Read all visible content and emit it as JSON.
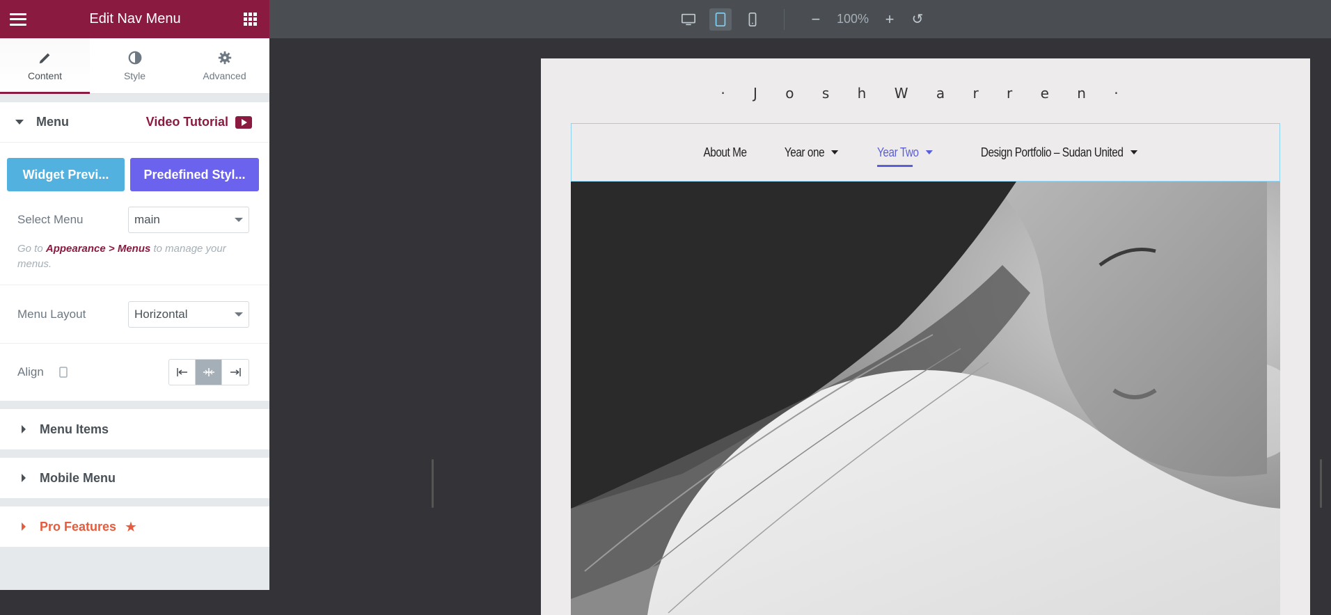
{
  "panel": {
    "title": "Edit Nav Menu",
    "tabs": [
      {
        "label": "Content",
        "icon": "pencil-icon"
      },
      {
        "label": "Style",
        "icon": "half-circle-icon"
      },
      {
        "label": "Advanced",
        "icon": "gear-icon"
      }
    ],
    "menu_section": {
      "title": "Menu",
      "video_tutorial": "Video Tutorial",
      "widget_preview_btn": "Widget Previ...",
      "predefined_style_btn": "Predefined Styl...",
      "select_menu_label": "Select Menu",
      "select_menu_value": "main",
      "hint_prefix": "Go to ",
      "hint_link": "Appearance > Menus",
      "hint_suffix": " to manage your menus.",
      "menu_layout_label": "Menu Layout",
      "menu_layout_value": "Horizontal",
      "align_label": "Align"
    },
    "collapsed_sections": [
      "Menu Items",
      "Mobile Menu"
    ],
    "pro_features": "Pro Features"
  },
  "toolbar": {
    "zoom": "100%"
  },
  "preview": {
    "site_title": "· J o s h   W a r r e n ·",
    "nav": [
      {
        "label": "About Me",
        "dropdown": false,
        "active": false
      },
      {
        "label": "Year one",
        "dropdown": true,
        "active": false
      },
      {
        "label": "Year Two",
        "dropdown": true,
        "active": true
      },
      {
        "label": "Design Portfolio – Sudan United",
        "dropdown": true,
        "active": false
      }
    ]
  },
  "colors": {
    "brand": "#8a1a3f",
    "widget_preview": "#53b1e0",
    "predefined_style": "#6b63ee",
    "pro": "#e55c3e",
    "nav_active": "#5b5fd6"
  }
}
